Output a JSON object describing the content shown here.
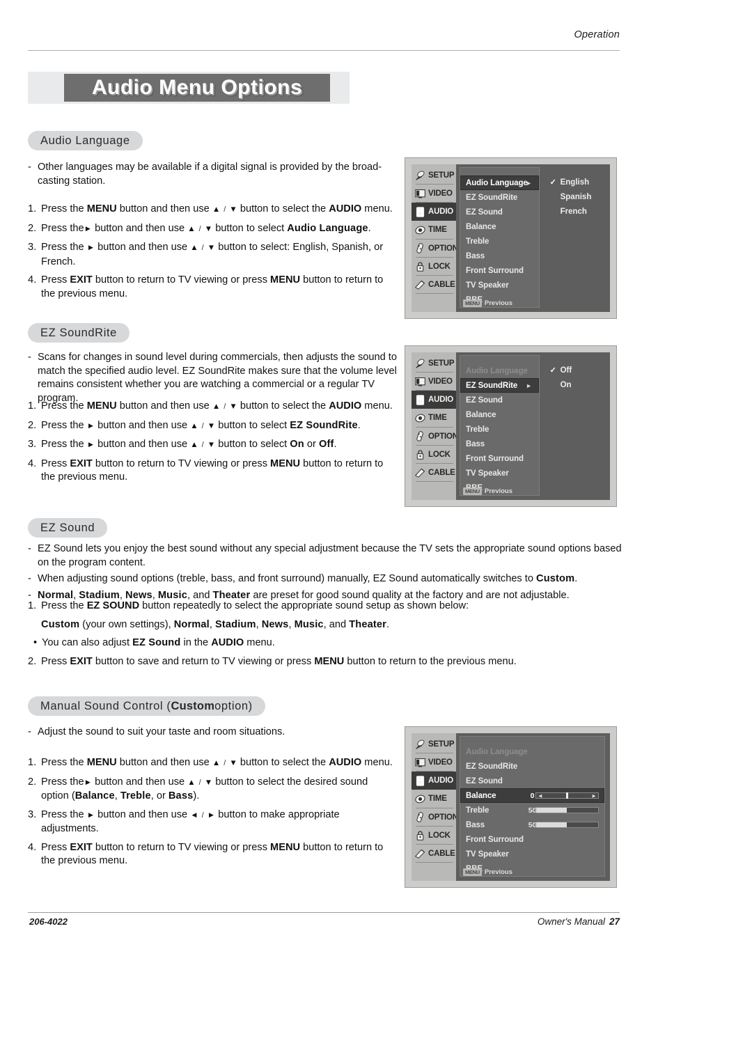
{
  "header": {
    "running_head": "Operation"
  },
  "title": {
    "text": "Audio Menu Options"
  },
  "sections": {
    "audio_language": {
      "heading": "Audio Language",
      "note_marker": "-",
      "note": "Other languages may be available if a digital signal is provided by the broad-casting station.",
      "steps": [
        {
          "num": "1.",
          "parts": [
            {
              "t": "Press the ",
              "s": "n"
            },
            {
              "t": "MENU",
              "s": "b"
            },
            {
              "t": " button and then use ",
              "s": "n"
            },
            {
              "t": "▲",
              "s": "a"
            },
            {
              "t": " / ",
              "s": "s"
            },
            {
              "t": "▼",
              "s": "a"
            },
            {
              "t": "  button to select the ",
              "s": "n"
            },
            {
              "t": "AUDIO",
              "s": "b"
            },
            {
              "t": " menu.",
              "s": "n"
            }
          ]
        },
        {
          "num": "2.",
          "parts": [
            {
              "t": "Press the",
              "s": "n"
            },
            {
              "t": "►",
              "s": "a"
            },
            {
              "t": " button and then use ",
              "s": "n"
            },
            {
              "t": "▲",
              "s": "a"
            },
            {
              "t": " / ",
              "s": "s"
            },
            {
              "t": "▼",
              "s": "a"
            },
            {
              "t": " button to select ",
              "s": "n"
            },
            {
              "t": "Audio Language",
              "s": "bb"
            },
            {
              "t": ".",
              "s": "n"
            }
          ]
        },
        {
          "num": "3.",
          "parts": [
            {
              "t": "Press the ",
              "s": "n"
            },
            {
              "t": "►",
              "s": "a"
            },
            {
              "t": "  button and then use ",
              "s": "n"
            },
            {
              "t": "▲",
              "s": "a"
            },
            {
              "t": " / ",
              "s": "s"
            },
            {
              "t": "▼",
              "s": "a"
            },
            {
              "t": " button to select: English, Spanish, or French.",
              "s": "n"
            }
          ]
        },
        {
          "num": "4.",
          "parts": [
            {
              "t": "Press ",
              "s": "n"
            },
            {
              "t": "EXIT",
              "s": "b"
            },
            {
              "t": " button to return to TV viewing or press ",
              "s": "n"
            },
            {
              "t": "MENU",
              "s": "b"
            },
            {
              "t": " button to return to the previous menu.",
              "s": "n"
            }
          ]
        }
      ]
    },
    "ez_soundrite": {
      "heading": "EZ SoundRite",
      "note_marker": "-",
      "note": "Scans for changes in sound level during commercials, then adjusts the sound to match the specified audio level. EZ SoundRite makes sure that the volume level remains consistent whether you are watching a commercial or a regular TV program.",
      "steps": [
        {
          "num": "1.",
          "parts": [
            {
              "t": "Press the ",
              "s": "n"
            },
            {
              "t": "MENU",
              "s": "b"
            },
            {
              "t": " button and then use ",
              "s": "n"
            },
            {
              "t": "▲",
              "s": "a"
            },
            {
              "t": " / ",
              "s": "s"
            },
            {
              "t": "▼",
              "s": "a"
            },
            {
              "t": "  button to select the ",
              "s": "n"
            },
            {
              "t": "AUDIO",
              "s": "b"
            },
            {
              "t": " menu.",
              "s": "n"
            }
          ]
        },
        {
          "num": "2.",
          "parts": [
            {
              "t": "Press the ",
              "s": "n"
            },
            {
              "t": "►",
              "s": "a"
            },
            {
              "t": " button and then use ",
              "s": "n"
            },
            {
              "t": "▲",
              "s": "a"
            },
            {
              "t": " / ",
              "s": "s"
            },
            {
              "t": "▼",
              "s": "a"
            },
            {
              "t": " button to select ",
              "s": "n"
            },
            {
              "t": "EZ SoundRite",
              "s": "bb"
            },
            {
              "t": ".",
              "s": "n"
            }
          ]
        },
        {
          "num": "3.",
          "parts": [
            {
              "t": "Press the ",
              "s": "n"
            },
            {
              "t": "►",
              "s": "a"
            },
            {
              "t": " button and then use ",
              "s": "n"
            },
            {
              "t": "▲",
              "s": "a"
            },
            {
              "t": " / ",
              "s": "s"
            },
            {
              "t": "▼",
              "s": "a"
            },
            {
              "t": " button to select ",
              "s": "n"
            },
            {
              "t": "On",
              "s": "bb"
            },
            {
              "t": " or ",
              "s": "n"
            },
            {
              "t": "Off",
              "s": "bb"
            },
            {
              "t": ".",
              "s": "n"
            }
          ]
        },
        {
          "num": "4.",
          "parts": [
            {
              "t": "Press ",
              "s": "n"
            },
            {
              "t": "EXIT",
              "s": "b"
            },
            {
              "t": " button to return to TV viewing or press ",
              "s": "n"
            },
            {
              "t": "MENU",
              "s": "b"
            },
            {
              "t": " button to return to the previous menu.",
              "s": "n"
            }
          ]
        }
      ]
    },
    "ez_sound": {
      "heading": "EZ Sound",
      "notes": [
        {
          "marker": "-",
          "parts": [
            {
              "t": "EZ Sound lets you enjoy the best sound without any special adjustment because the TV sets the appropriate sound options based on the program content.",
              "s": "n"
            }
          ]
        },
        {
          "marker": "-",
          "parts": [
            {
              "t": "When adjusting sound options (treble, bass, and front surround) manually, EZ Sound automatically switches to ",
              "s": "n"
            },
            {
              "t": "Custom",
              "s": "bb"
            },
            {
              "t": ".",
              "s": "n"
            }
          ]
        },
        {
          "marker": "-",
          "parts": [
            {
              "t": "Normal",
              "s": "bb"
            },
            {
              "t": ", ",
              "s": "n"
            },
            {
              "t": "Stadium",
              "s": "bb"
            },
            {
              "t": ", ",
              "s": "n"
            },
            {
              "t": "News",
              "s": "bb"
            },
            {
              "t": ", ",
              "s": "n"
            },
            {
              "t": "Music",
              "s": "bb"
            },
            {
              "t": ", and ",
              "s": "n"
            },
            {
              "t": "Theater",
              "s": "bb"
            },
            {
              "t": " are preset for good sound quality at the factory and are not adjustable.",
              "s": "n"
            }
          ]
        }
      ],
      "steps": [
        {
          "num": "1.",
          "parts": [
            {
              "t": "Press the ",
              "s": "n"
            },
            {
              "t": "EZ SOUND",
              "s": "b"
            },
            {
              "t": " button repeatedly to select the appropriate sound setup as shown below:",
              "s": "n"
            }
          ]
        },
        {
          "num": "",
          "parts": [
            {
              "t": "Custom",
              "s": "bb"
            },
            {
              "t": " (your own settings), ",
              "s": "n"
            },
            {
              "t": "Normal",
              "s": "bb"
            },
            {
              "t": ", ",
              "s": "n"
            },
            {
              "t": "Stadium",
              "s": "bb"
            },
            {
              "t": ", ",
              "s": "n"
            },
            {
              "t": "News",
              "s": "bb"
            },
            {
              "t": ", ",
              "s": "n"
            },
            {
              "t": "Music",
              "s": "bb"
            },
            {
              "t": ", and ",
              "s": "n"
            },
            {
              "t": "Theater",
              "s": "bb"
            },
            {
              "t": ".",
              "s": "n"
            }
          ]
        },
        {
          "num": "•",
          "parts": [
            {
              "t": "You can also adjust ",
              "s": "n"
            },
            {
              "t": "EZ Sound",
              "s": "bb"
            },
            {
              "t": " in the ",
              "s": "n"
            },
            {
              "t": "AUDIO",
              "s": "b"
            },
            {
              "t": " menu.",
              "s": "n"
            }
          ]
        },
        {
          "num": "2.",
          "parts": [
            {
              "t": "Press ",
              "s": "n"
            },
            {
              "t": "EXIT",
              "s": "b"
            },
            {
              "t": " button to save and return to TV viewing or press ",
              "s": "n"
            },
            {
              "t": "MENU",
              "s": "b"
            },
            {
              "t": " button to return to the previous menu.",
              "s": "n"
            }
          ]
        }
      ]
    },
    "manual_sound_control": {
      "heading_pre": "Manual Sound Control (",
      "heading_bold": "Custom",
      "heading_post": " option)",
      "note_marker": "-",
      "note": "Adjust the sound to suit your taste and room situations.",
      "steps": [
        {
          "num": "1.",
          "parts": [
            {
              "t": "Press the ",
              "s": "n"
            },
            {
              "t": "MENU",
              "s": "b"
            },
            {
              "t": " button and then use ",
              "s": "n"
            },
            {
              "t": "▲",
              "s": "a"
            },
            {
              "t": " / ",
              "s": "s"
            },
            {
              "t": "▼",
              "s": "a"
            },
            {
              "t": "  button to select the ",
              "s": "n"
            },
            {
              "t": "AUDIO",
              "s": "b"
            },
            {
              "t": " menu.",
              "s": "n"
            }
          ]
        },
        {
          "num": "2.",
          "parts": [
            {
              "t": "Press the",
              "s": "n"
            },
            {
              "t": "►",
              "s": "a"
            },
            {
              "t": " button and then use ",
              "s": "n"
            },
            {
              "t": "▲",
              "s": "a"
            },
            {
              "t": " / ",
              "s": "s"
            },
            {
              "t": "▼",
              "s": "a"
            },
            {
              "t": " button to select the desired sound option (",
              "s": "n"
            },
            {
              "t": "Balance",
              "s": "bb"
            },
            {
              "t": ", ",
              "s": "n"
            },
            {
              "t": "Treble",
              "s": "bb"
            },
            {
              "t": ", or ",
              "s": "n"
            },
            {
              "t": "Bass",
              "s": "bb"
            },
            {
              "t": ").",
              "s": "n"
            }
          ]
        },
        {
          "num": "3.",
          "parts": [
            {
              "t": "Press the ",
              "s": "n"
            },
            {
              "t": "►",
              "s": "a"
            },
            {
              "t": " button and then use ",
              "s": "n"
            },
            {
              "t": "◄",
              "s": "a"
            },
            {
              "t": " / ",
              "s": "s"
            },
            {
              "t": "►",
              "s": "a"
            },
            {
              "t": " button to make appropriate adjustments.",
              "s": "n"
            }
          ]
        },
        {
          "num": "4.",
          "parts": [
            {
              "t": "Press ",
              "s": "n"
            },
            {
              "t": "EXIT",
              "s": "b"
            },
            {
              "t": " button to return to TV viewing or press ",
              "s": "n"
            },
            {
              "t": "MENU",
              "s": "b"
            },
            {
              "t": " button to return to the previous menu.",
              "s": "n"
            }
          ]
        }
      ]
    }
  },
  "osd_rail": [
    {
      "label": "SETUP",
      "icon": "satellite-dish-icon",
      "active": false
    },
    {
      "label": "VIDEO",
      "icon": "monitor-icon",
      "active": false
    },
    {
      "label": "AUDIO",
      "icon": "speaker-icon",
      "active": true
    },
    {
      "label": "TIME",
      "icon": "clock-icon",
      "active": false
    },
    {
      "label": "OPTION",
      "icon": "remote-icon",
      "active": false
    },
    {
      "label": "LOCK",
      "icon": "padlock-icon",
      "active": false
    },
    {
      "label": "CABLE",
      "icon": "plug-icon",
      "active": false
    }
  ],
  "osd_previous_label": "Previous",
  "osd_previous_key": "MENU",
  "osd_screens": {
    "audio_language": {
      "rows": [
        {
          "label": "Audio Language",
          "state": "selected",
          "caret": "►"
        },
        {
          "label": "EZ SoundRite",
          "state": "normal"
        },
        {
          "label": "EZ Sound",
          "state": "normal"
        },
        {
          "label": "Balance",
          "state": "normal"
        },
        {
          "label": "Treble",
          "state": "normal"
        },
        {
          "label": "Bass",
          "state": "normal"
        },
        {
          "label": "Front Surround",
          "state": "normal"
        },
        {
          "label": "TV Speaker",
          "state": "normal"
        },
        {
          "label": "BBE",
          "state": "normal"
        }
      ],
      "options": [
        {
          "label": "English",
          "checked": true
        },
        {
          "label": "Spanish",
          "checked": false
        },
        {
          "label": "French",
          "checked": false
        }
      ]
    },
    "ez_soundrite": {
      "rows": [
        {
          "label": "Audio Language",
          "state": "dim"
        },
        {
          "label": "EZ SoundRite",
          "state": "selected",
          "caret": "►"
        },
        {
          "label": "EZ Sound",
          "state": "normal"
        },
        {
          "label": "Balance",
          "state": "normal"
        },
        {
          "label": "Treble",
          "state": "normal"
        },
        {
          "label": "Bass",
          "state": "normal"
        },
        {
          "label": "Front Surround",
          "state": "normal"
        },
        {
          "label": "TV Speaker",
          "state": "normal"
        },
        {
          "label": "BBE",
          "state": "normal"
        }
      ],
      "options": [
        {
          "label": "Off",
          "checked": true
        },
        {
          "label": "On",
          "checked": false
        }
      ]
    },
    "manual_sound_control": {
      "rows": [
        {
          "label": "Audio Language",
          "state": "dim"
        },
        {
          "label": "EZ SoundRite",
          "state": "normal"
        },
        {
          "label": "EZ Sound",
          "state": "normal"
        },
        {
          "label": "Balance",
          "state": "selected",
          "value": "0",
          "slider": "center"
        },
        {
          "label": "Treble",
          "state": "normal",
          "value": "50",
          "slider": "fill",
          "percent": 50
        },
        {
          "label": "Bass",
          "state": "normal",
          "value": "50",
          "slider": "fill",
          "percent": 50
        },
        {
          "label": "Front Surround",
          "state": "normal"
        },
        {
          "label": "TV Speaker",
          "state": "normal"
        },
        {
          "label": "BBE",
          "state": "normal"
        }
      ]
    }
  },
  "footer": {
    "doc_number": "206-4022",
    "manual_label": "Owner's Manual",
    "page_number": "27"
  }
}
